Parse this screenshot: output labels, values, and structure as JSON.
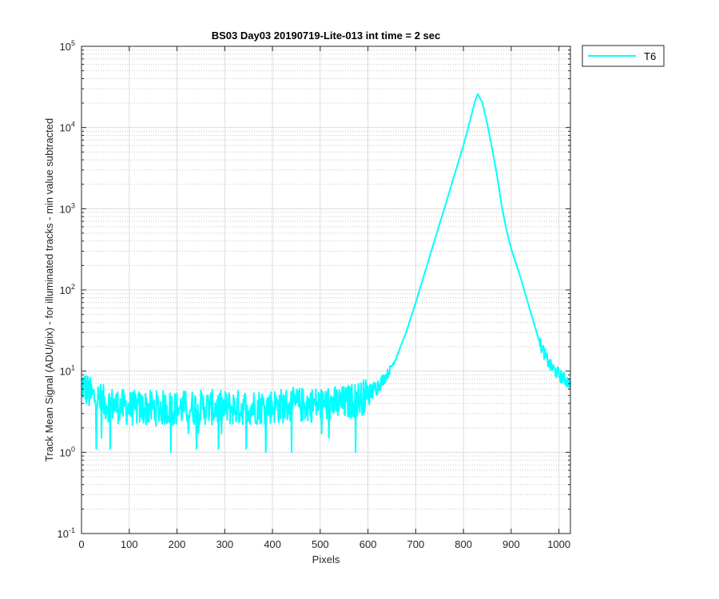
{
  "chart_data": {
    "type": "line",
    "title": "BS03 Day03 20190719-Lite-013 int time = 2 sec",
    "xlabel": "Pixels",
    "ylabel": "Track Mean Signal (ADU/pix) - for illuminated tracks - min value subtracted",
    "xlim": [
      0,
      1024
    ],
    "ylim": [
      0.1,
      100000
    ],
    "yscale": "log",
    "grid": true,
    "minor_grid": true,
    "legend_position": "outside-top-right",
    "xticks": [
      0,
      100,
      200,
      300,
      400,
      500,
      600,
      700,
      800,
      900,
      1000
    ],
    "xtick_labels": [
      "0",
      "100",
      "200",
      "300",
      "400",
      "500",
      "600",
      "700",
      "800",
      "900",
      "1000"
    ],
    "yticks": [
      0.1,
      1,
      10,
      100,
      1000,
      10000,
      100000
    ],
    "ytick_labels": [
      {
        "base": "10",
        "exp": "-1"
      },
      {
        "base": "10",
        "exp": "0"
      },
      {
        "base": "10",
        "exp": "1"
      },
      {
        "base": "10",
        "exp": "2"
      },
      {
        "base": "10",
        "exp": "3"
      },
      {
        "base": "10",
        "exp": "4"
      },
      {
        "base": "10",
        "exp": "5"
      }
    ],
    "series": [
      {
        "name": "T6",
        "color": "#00FFFF",
        "noise_baseline": {
          "x_range": [
            0,
            600
          ],
          "mean": 3.5,
          "min_dips": [
            1.0,
            1.1,
            1.5,
            1.7
          ]
        },
        "x": [
          0,
          20,
          50,
          100,
          150,
          200,
          250,
          300,
          350,
          400,
          450,
          500,
          550,
          600,
          620,
          640,
          660,
          680,
          700,
          720,
          740,
          760,
          780,
          800,
          815,
          825,
          830,
          840,
          850,
          860,
          870,
          880,
          890,
          900,
          920,
          940,
          960,
          980,
          1000,
          1024
        ],
        "values": [
          7,
          5,
          4,
          3.5,
          3.5,
          3.5,
          3.6,
          3.5,
          3.6,
          3.7,
          3.8,
          3.9,
          4.0,
          5.0,
          6.5,
          9,
          15,
          30,
          70,
          170,
          420,
          1000,
          2500,
          6000,
          13000,
          22000,
          26000,
          20000,
          11000,
          5500,
          2600,
          1100,
          550,
          320,
          140,
          55,
          22,
          12,
          9,
          7
        ]
      }
    ]
  }
}
